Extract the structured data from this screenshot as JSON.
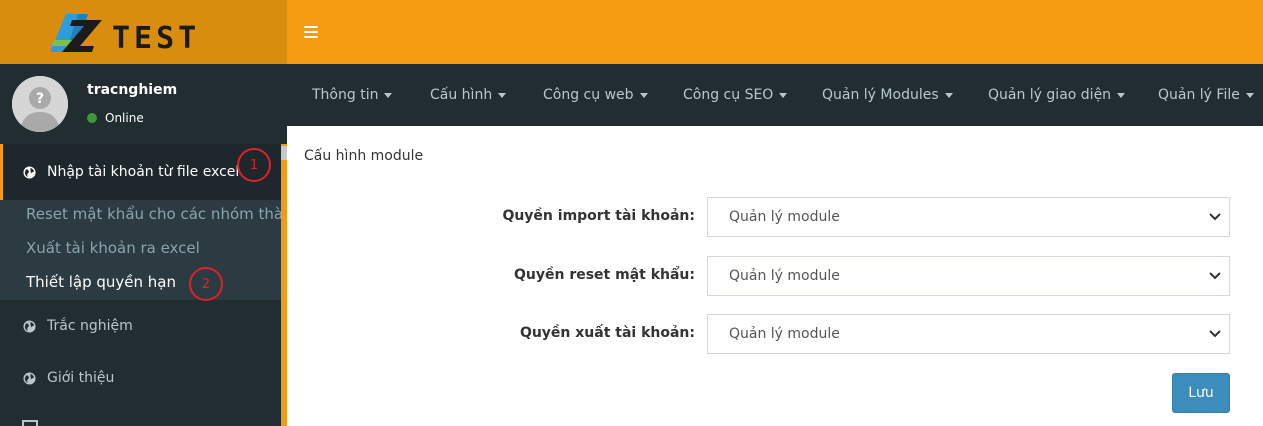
{
  "brand": {
    "logo_text": "AZTEST",
    "accent": "#f39c12"
  },
  "user": {
    "name": "tracnghiem",
    "status": "Online"
  },
  "sidebar": {
    "active_item": {
      "label": "Nhập tài khoản từ file excel",
      "icon": "globe-icon"
    },
    "submenu": [
      {
        "label": "Reset mật khẩu cho các nhóm thàn"
      },
      {
        "label": "Xuất tài khoản ra excel"
      },
      {
        "label": "Thiết lập quyền hạn"
      }
    ],
    "items": [
      {
        "label": "Trắc nghiệm",
        "icon": "globe-icon"
      },
      {
        "label": "Giới thiệu",
        "icon": "globe-icon"
      }
    ]
  },
  "annotations": {
    "badge1": "1",
    "badge2": "2"
  },
  "nav": [
    {
      "label": "Thông tin"
    },
    {
      "label": "Cấu hình"
    },
    {
      "label": "Công cụ web"
    },
    {
      "label": "Công cụ SEO"
    },
    {
      "label": "Quản lý Modules"
    },
    {
      "label": "Quản lý giao diện"
    },
    {
      "label": "Quản lý File"
    }
  ],
  "content": {
    "title": "Cấu hình module",
    "fields": [
      {
        "label": "Quyền import tài khoản:",
        "value": "Quản lý module"
      },
      {
        "label": "Quyền reset mật khẩu:",
        "value": "Quản lý module"
      },
      {
        "label": "Quyền xuất tài khoản:",
        "value": "Quản lý module"
      }
    ],
    "save_label": "Lưu"
  }
}
